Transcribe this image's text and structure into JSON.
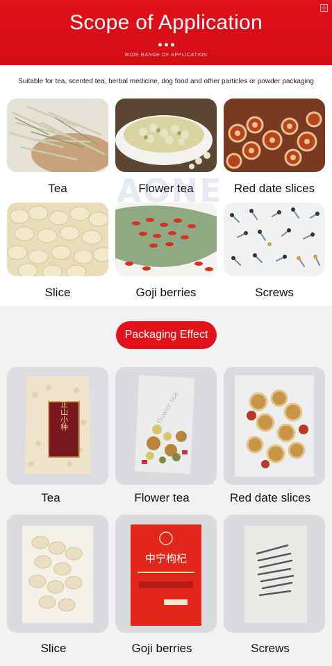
{
  "header": {
    "title": "Scope of Application",
    "subtitle": "WIDE RANGE OF APPLICATION",
    "corner_icon": "expand-grid-icon"
  },
  "intro": "Suitable for tea, scented tea, herbal medicine, dog food and other particles or powder packaging",
  "watermark": "AONE",
  "applications": [
    {
      "label": "Tea"
    },
    {
      "label": "Flower tea"
    },
    {
      "label": "Red date slices"
    },
    {
      "label": "Slice"
    },
    {
      "label": "Goji berries"
    },
    {
      "label": "Screws"
    }
  ],
  "packaging": {
    "heading": "Packaging Effect",
    "items": [
      {
        "label": "Tea",
        "pack_text": "正山小种"
      },
      {
        "label": "Flower tea",
        "pack_text": "flower tea"
      },
      {
        "label": "Red date slices"
      },
      {
        "label": "Slice"
      },
      {
        "label": "Goji berries",
        "pack_text": "中宁枸杞"
      },
      {
        "label": "Screws"
      }
    ]
  },
  "colors": {
    "brand_red": "#e2121b",
    "section_gray": "#f2f2f3"
  }
}
